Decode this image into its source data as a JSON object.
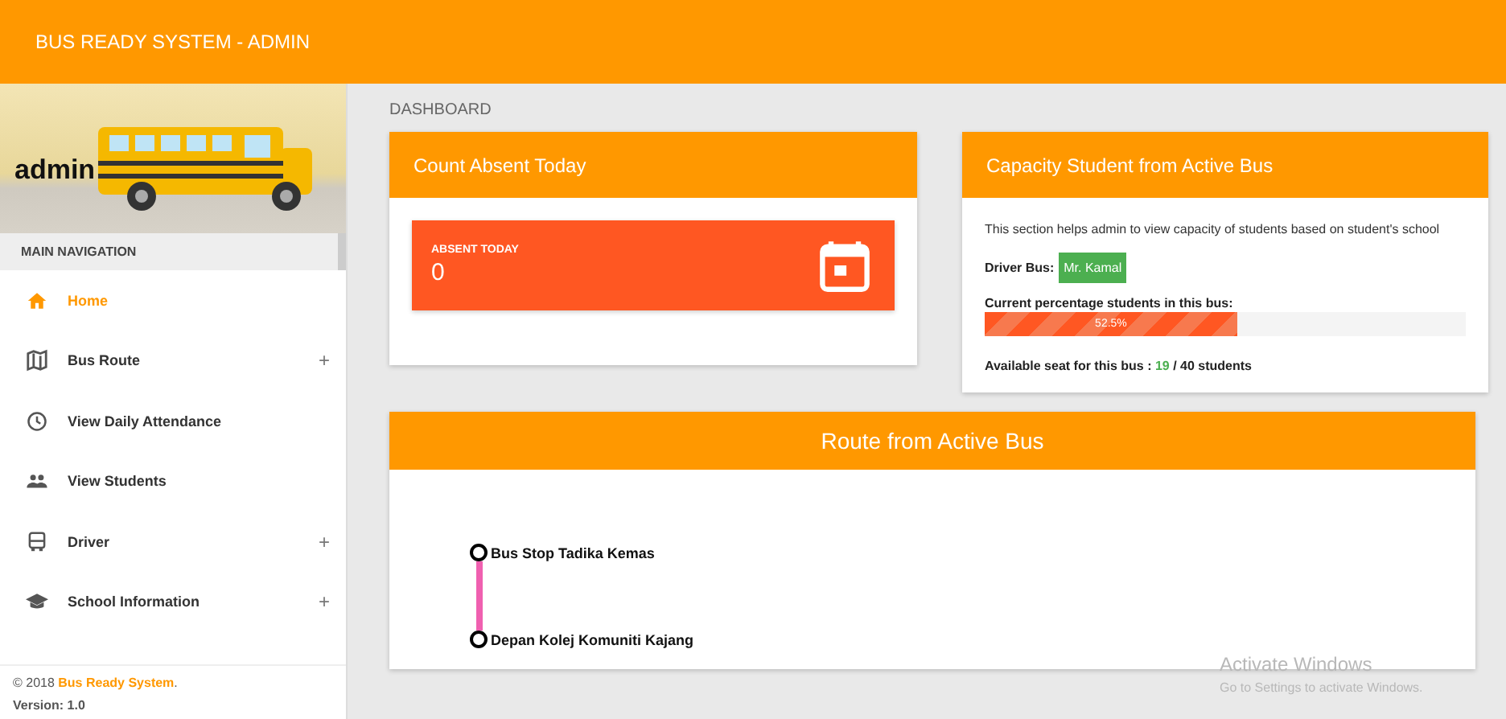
{
  "app_bar": {
    "title": "BUS READY SYSTEM - ADMIN"
  },
  "sidebar": {
    "user": {
      "name": "admin"
    },
    "header": "MAIN NAVIGATION",
    "items": [
      {
        "label": "Home",
        "kind": "home",
        "selected": true,
        "expandable": false
      },
      {
        "label": "Bus Route",
        "kind": "map",
        "selected": false,
        "expandable": true
      },
      {
        "label": "View Daily Attendance",
        "kind": "clock",
        "selected": false,
        "expandable": false
      },
      {
        "label": "View Students",
        "kind": "people",
        "selected": false,
        "expandable": false
      },
      {
        "label": "Driver",
        "kind": "bus",
        "selected": false,
        "expandable": true
      },
      {
        "label": "School Information",
        "kind": "school",
        "selected": false,
        "expandable": true
      }
    ],
    "expand_sign": "+",
    "footer": {
      "copyright": "© 2018 ",
      "brand": "Bus Ready System",
      "period": ".",
      "version": "Version: 1.0"
    }
  },
  "breadcrumb": "DASHBOARD",
  "absent_card": {
    "title": "Count Absent Today",
    "tile_label": "ABSENT TODAY",
    "tile_value": "0"
  },
  "capacity_card": {
    "title": "Capacity Student from Active Bus",
    "description": "This section helps admin to view capacity of students based on student's school",
    "driver_label": "Driver Bus:",
    "driver_name": "Mr. Kamal",
    "percentage_label": "Current percentage students in this bus:",
    "progress": {
      "level": 0.525,
      "reading": "52.5%"
    },
    "seat_label": "Available seat for this bus : ",
    "seat_available": "19",
    "seat_total": " / 40 students"
  },
  "route_card": {
    "title": "Route from Active Bus",
    "stops": [
      "Bus Stop Tadika Kemas",
      "Depan Kolej Komuniti Kajang"
    ]
  },
  "os_notice": {
    "title": "Activate Windows",
    "subtitle": "Go to Settings to activate Windows."
  }
}
